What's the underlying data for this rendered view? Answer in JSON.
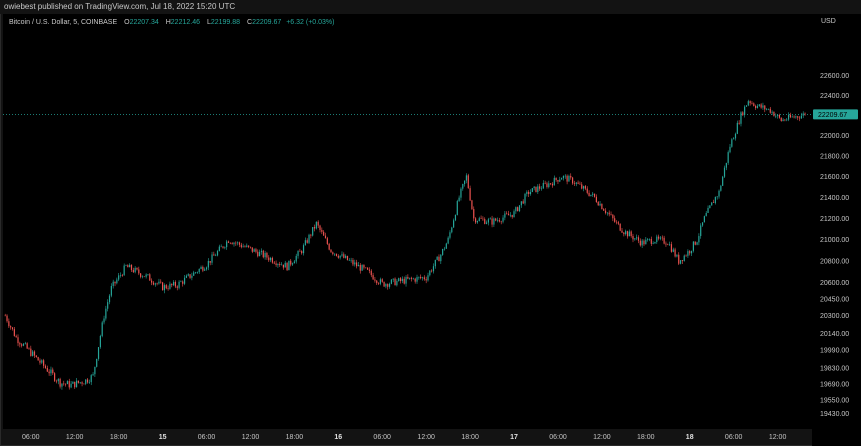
{
  "header": {
    "publish_line": "owiebest published on TradingView.com, Jul 18, 2022 15:20 UTC"
  },
  "legend": {
    "symbol": "Bitcoin / U.S. Dollar, 5, COINBASE",
    "open_label": "O",
    "open_value": "22207.34",
    "high_label": "H",
    "high_value": "22212.46",
    "low_label": "L",
    "low_value": "22199.88",
    "close_label": "C",
    "close_value": "22209.67",
    "change": "+6.32 (+0.03%)"
  },
  "colors": {
    "up": "#26a69a",
    "down": "#ef5350",
    "background": "#000000",
    "axis_text": "#c6c6c6",
    "last_price_tag": "#26a69a"
  },
  "chart_data": {
    "type": "candlestick",
    "timeframe": "5",
    "currency": "USD",
    "scale": "logarithmic",
    "grid": false,
    "last_price": "22209.67",
    "y_ticks": [
      "22600.00",
      "22400.00",
      "22200.00",
      "22000.00",
      "21800.00",
      "21600.00",
      "21400.00",
      "21200.00",
      "21000.00",
      "20800.00",
      "20600.00",
      "20450.00",
      "20300.00",
      "20140.00",
      "19990.00",
      "19830.00",
      "19690.00",
      "19550.00",
      "19430.00"
    ],
    "x_ticks": [
      "06:00",
      "12:00",
      "18:00",
      "15",
      "06:00",
      "12:00",
      "18:00",
      "16",
      "06:00",
      "12:00",
      "18:00",
      "17",
      "06:00",
      "12:00",
      "18:00",
      "18",
      "06:00",
      "12:00"
    ],
    "x_tick_bold": [
      false,
      false,
      false,
      true,
      false,
      false,
      false,
      true,
      false,
      false,
      false,
      true,
      false,
      false,
      false,
      true,
      false,
      false
    ],
    "x_tick_hours": [
      6,
      12,
      18,
      24,
      30,
      36,
      42,
      48,
      54,
      60,
      66,
      72,
      78,
      84,
      90,
      96,
      102,
      108
    ],
    "x_range_hours": [
      2.2,
      112.7
    ],
    "y_range": [
      19340,
      22960
    ],
    "price_path": {
      "hours": [
        2.5,
        4,
        7,
        10,
        11.5,
        13.5,
        14.5,
        16,
        17,
        19,
        22,
        24,
        26,
        30,
        33,
        37,
        41,
        43,
        45,
        47,
        52,
        54,
        56,
        58,
        60,
        62,
        63,
        64.5,
        65.5,
        66.5,
        69,
        72,
        74,
        77,
        78.5,
        80,
        83,
        86,
        87,
        89.5,
        91,
        93,
        94.5,
        96,
        97,
        98,
        99.5,
        100,
        101.5,
        103,
        104,
        105,
        107,
        108.5,
        110,
        111.8
      ],
      "prices": [
        20300,
        20100,
        19900,
        19700,
        19680,
        19720,
        19760,
        20300,
        20550,
        20750,
        20650,
        20560,
        20580,
        20770,
        21000,
        20880,
        20750,
        20900,
        21150,
        20900,
        20700,
        20590,
        20610,
        20630,
        20650,
        20860,
        21000,
        21400,
        21600,
        21200,
        21170,
        21250,
        21450,
        21540,
        21600,
        21560,
        21400,
        21150,
        21080,
        20970,
        21000,
        20980,
        20800,
        20900,
        21000,
        21200,
        21400,
        21450,
        21900,
        22200,
        22350,
        22300,
        22250,
        22150,
        22180,
        22209.67
      ]
    }
  }
}
